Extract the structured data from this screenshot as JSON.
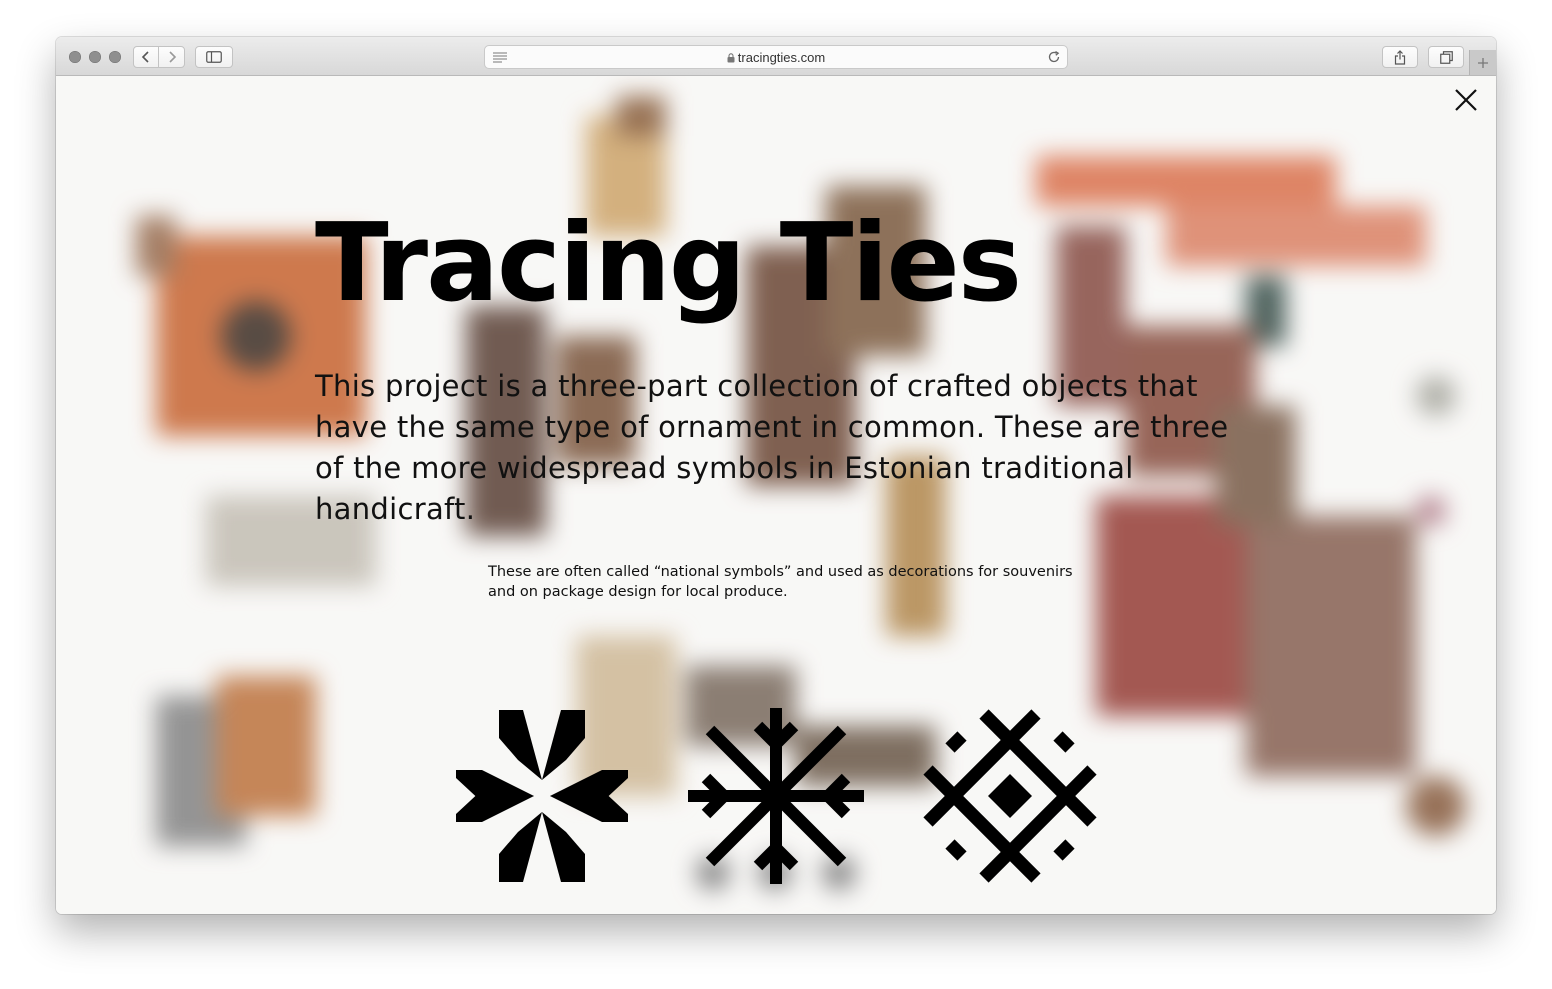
{
  "browser": {
    "url": "tracingties.com",
    "icons": {
      "back": "chevron-left-icon",
      "forward": "chevron-right-icon",
      "sidebar": "sidebar-icon",
      "reader": "reader-icon",
      "lock": "lock-icon",
      "reload": "reload-icon",
      "share": "share-icon",
      "tabs": "tabs-overview-icon",
      "new_tab": "plus-icon"
    }
  },
  "modal": {
    "title": "Tracing Ties",
    "lead": "This project is a three-part collection of crafted objects that have the same type of ornament in common. These are three of the more widespread symbols in Estonian traditional handicraft.",
    "note": "These are often called “national symbols” and used as decorations for souvenirs and on package design for local produce.",
    "close_icon": "close-icon",
    "symbols": [
      "eight-point-star-symbol",
      "snowflake-cross-symbol",
      "lattice-diamond-symbol"
    ]
  },
  "colors": {
    "symbol": "#000000",
    "text": "#111111",
    "chrome": "#dcdcdc"
  }
}
